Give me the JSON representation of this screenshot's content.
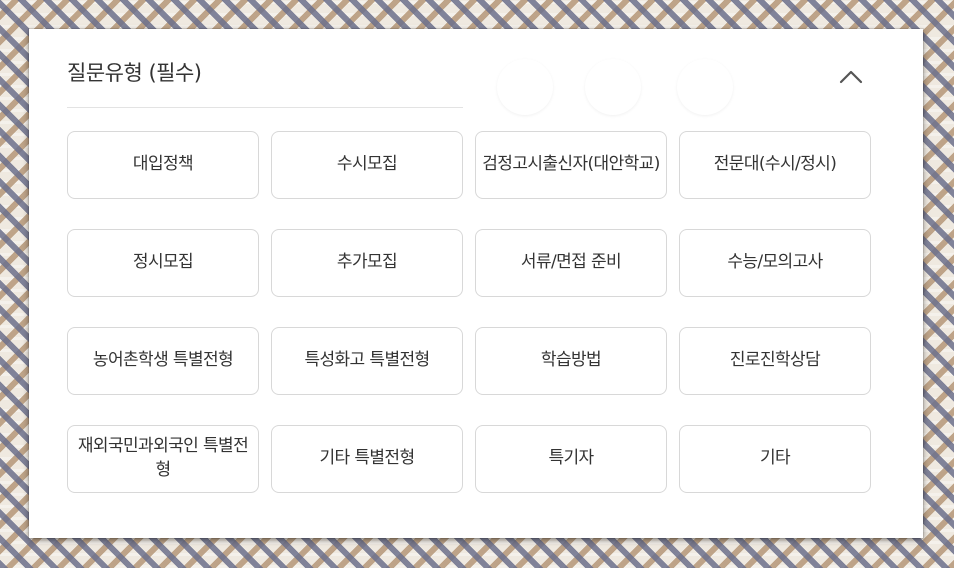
{
  "section": {
    "title": "질문유형 (필수)",
    "collapse_icon": "chevron-up-icon"
  },
  "options": [
    "대입정책",
    "수시모집",
    "검정고시출신자(대안학교)",
    "전문대(수시/정시)",
    "정시모집",
    "추가모집",
    "서류/면접 준비",
    "수능/모의고사",
    "농어촌학생 특별전형",
    "특성화고 특별전형",
    "학습방법",
    "진로진학상담",
    "재외국민과외국인 특별전형",
    "기타 특별전형",
    "특기자",
    "기타"
  ]
}
